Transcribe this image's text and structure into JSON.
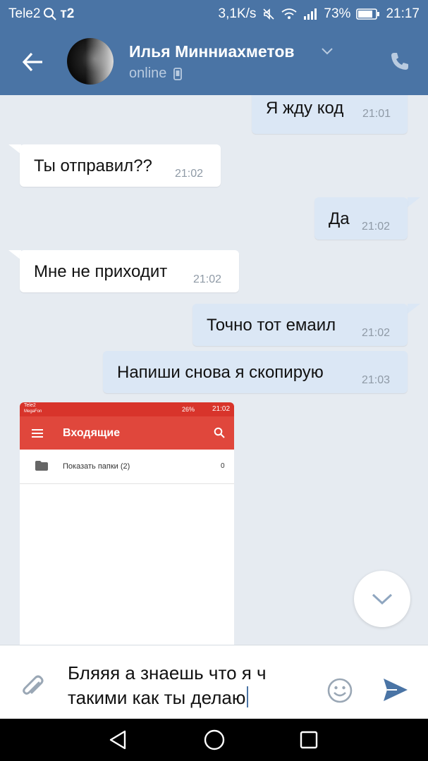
{
  "status_bar": {
    "carrier": "Tele2",
    "carrier_badge": "т2",
    "speed": "3,1K/s",
    "battery": "73%",
    "time": "21:17"
  },
  "header": {
    "contact_name": "Илья Минниахметов",
    "status": "online"
  },
  "messages": [
    {
      "text": "Я жду код",
      "time": "21:01",
      "direction": "out"
    },
    {
      "text": "Ты отправил??",
      "time": "21:02",
      "direction": "in"
    },
    {
      "text": "Да",
      "time": "21:02",
      "direction": "out"
    },
    {
      "text": "Мне не приходит",
      "time": "21:02",
      "direction": "in"
    },
    {
      "text": "Точно тот емаил",
      "time": "21:02",
      "direction": "out"
    },
    {
      "text": "Напиши снова я скопирую",
      "time": "21:03",
      "direction": "out"
    }
  ],
  "attachment": {
    "carrier": "Tele2",
    "carrier_sub": "MegaFon",
    "battery": "26%",
    "time": "21:02",
    "title": "Входящие",
    "row_label": "Показать папки (2)",
    "row_count": "0"
  },
  "composer": {
    "line1": "Бляяя а знаешь что я ч",
    "line2": "такими как ты делаю"
  },
  "colors": {
    "accent": "#4a74a5",
    "chat_bg": "#e6ebf1",
    "out_bubble": "#dbe7f5",
    "in_bubble": "#ffffff",
    "mail_red": "#e0473c"
  },
  "icons": [
    "back-arrow-icon",
    "chevron-down-icon",
    "phone-icon",
    "mobile-icon",
    "scroll-down-icon",
    "paperclip-icon",
    "emoji-icon",
    "send-icon",
    "nav-back-icon",
    "nav-home-icon",
    "nav-recents-icon"
  ]
}
